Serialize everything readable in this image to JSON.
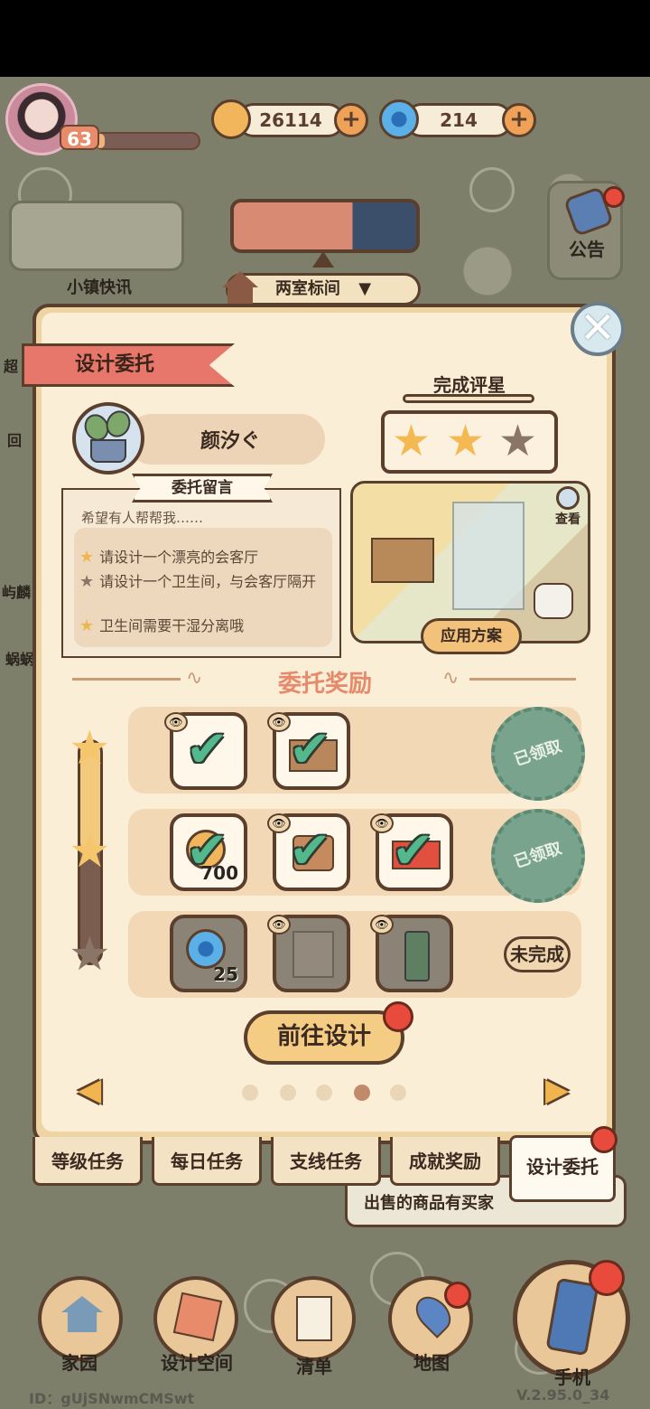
{
  "top_bar": {
    "level": "63",
    "xp_progress": 0.06,
    "coins": "26114",
    "gems": "214",
    "add_symbol": "+"
  },
  "hud": {
    "news_label": "小镇快讯",
    "room_selector": "两室标间",
    "notice_label": "公告",
    "side_labels": [
      "超",
      "回",
      "屿麟",
      "蜗蜗"
    ]
  },
  "dialog": {
    "title": "设计委托",
    "close_symbol": "✕",
    "client_name": "颜汐ぐ",
    "message_tag": "委托留言",
    "message_intro": "希望有人帮帮我……",
    "requirements": [
      {
        "text": "请设计一个漂亮的会客厅",
        "done": true
      },
      {
        "text": "请设计一个卫生间，与会客厅隔开",
        "done": false
      },
      {
        "text": "卫生间需要干湿分离哦",
        "done": true
      }
    ],
    "rating_label": "完成评星",
    "rating": 2,
    "rating_max": 3,
    "view_label": "查看",
    "apply_label": "应用方案",
    "reward_title": "委托奖励",
    "reward_rows": [
      {
        "status": "已领取",
        "items": [
          "branch",
          "crate"
        ]
      },
      {
        "status": "已领取",
        "items": [
          "coin-700",
          "chair",
          "box"
        ]
      },
      {
        "status": "未完成",
        "items": [
          "gem-25",
          "cabinet",
          "fridge"
        ]
      }
    ],
    "coin_count": "700",
    "gem_count": "25",
    "claimed_label": "已领取",
    "incomplete_label": "未完成",
    "goto_label": "前往设计",
    "page_dots": 5,
    "page_current": 4
  },
  "tabs": [
    {
      "label": "等级任务",
      "active": false
    },
    {
      "label": "每日任务",
      "active": false
    },
    {
      "label": "支线任务",
      "active": false
    },
    {
      "label": "成就奖励",
      "active": false
    },
    {
      "label": "设计委托",
      "active": true
    }
  ],
  "toast": "出售的商品有买家",
  "bottom_nav": {
    "home": "家园",
    "design_space": "设计空间",
    "list": "清单",
    "map": "地图",
    "phone": "手机"
  },
  "footer": {
    "id": "ID：gUjSNwmCMSwt",
    "version": "V.2.95.0_34"
  },
  "colors": {
    "accent": "#e8776b",
    "border": "#5b3f2d",
    "panel": "#fbeed7",
    "check": "#53b88c",
    "stamp": "#7aa38d"
  }
}
